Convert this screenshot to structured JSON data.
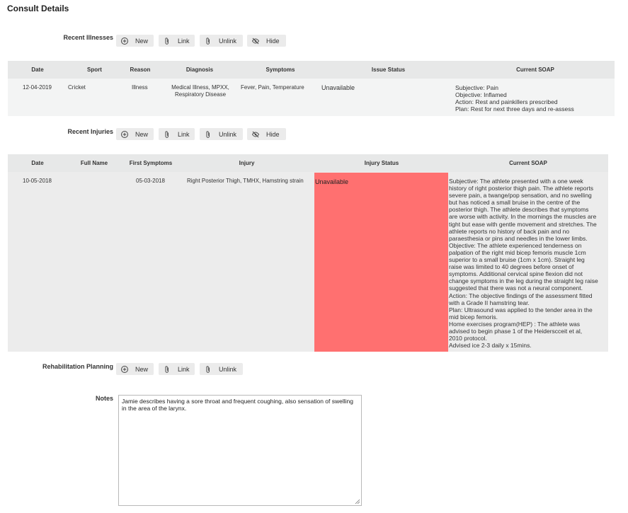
{
  "page": {
    "title": "Consult Details"
  },
  "actions": {
    "new": "New",
    "link": "Link",
    "unlink": "Unlink",
    "hide": "Hide"
  },
  "recent_illnesses": {
    "label": "Recent Illnesses",
    "headers": [
      "Date",
      "Sport",
      "Reason",
      "Diagnosis",
      "Symptoms",
      "Issue Status",
      "Current SOAP"
    ],
    "row": {
      "date": "12-04-2019",
      "sport": "Cricket",
      "reason": "Illness",
      "diagnosis_1": "Medical Illness, MPXX,",
      "diagnosis_2": "Respiratory Disease",
      "symptoms": "Fever, Pain, Temperature",
      "status": "Unavailable",
      "soap": [
        "Subjective: Pain",
        "Objective: Inflamed",
        "Action: Rest and painkillers prescribed",
        "Plan: Rest for next three days and re-assess"
      ]
    }
  },
  "recent_injuries": {
    "label": "Recent Injuries",
    "headers": [
      "Date",
      "Full Name",
      "First Symptoms",
      "Injury",
      "Injury Status",
      "Current SOAP"
    ],
    "row": {
      "date": "10-05-2018",
      "full_name": "",
      "first_symptoms": "05-03-2018",
      "injury": "Right Posterior Thigh, TMHX, Hamstring strain",
      "status": "Unavailable",
      "status_color": "#ff7070",
      "soap": [
        "Subjective: The athlete presented with a one week",
        "history of right posterior thigh pain. The athlete reports",
        "severe pain, a twange/pop sensation, and no swelling",
        "but has noticed a small bruise in the centre of the",
        "posterior thigh. The athlete describes that symptoms",
        "are worse with activity. In the mornings the muscles are",
        "tight but ease with gentle movement and stretches. The",
        "athlete reports no history of back pain and no",
        "paraesthesia or pins and needles in the lower limbs.",
        "Objective: The athlete experienced tenderness on",
        "palpation of the right mid bicep femoris muscle 1cm",
        "superior to a small bruise (1cm x 1cm). Straight leg",
        "raise was limited to 40 degrees before onset of",
        "symptoms. Additional cervical spine flexion did not",
        "change symptoms in the leg during the straight leg raise",
        "suggested that there was not a neural component.",
        "Action: The objective findings of the assessment fitted",
        "with a Grade II hamstring tear.",
        "Plan: Ultrasound was applied to the tender area in the",
        "mid bicep femoris.",
        "Home exercises program(HEP) : The athlete was",
        "advised to begin phase 1 of the Heiderscceit et al,",
        "2010 protocol.",
        "Advised ice 2-3 daily x 15mins."
      ]
    }
  },
  "rehabilitation": {
    "label": "Rehabilitation Planning"
  },
  "notes": {
    "label": "Notes",
    "value": "Jamie describes having a sore throat and frequent coughing, also sensation of swelling in the area of the larynx."
  },
  "icons": {
    "new": "plus-circle-icon",
    "link": "paperclip-icon",
    "unlink": "paperclip-icon",
    "hide": "eye-slash-icon"
  }
}
